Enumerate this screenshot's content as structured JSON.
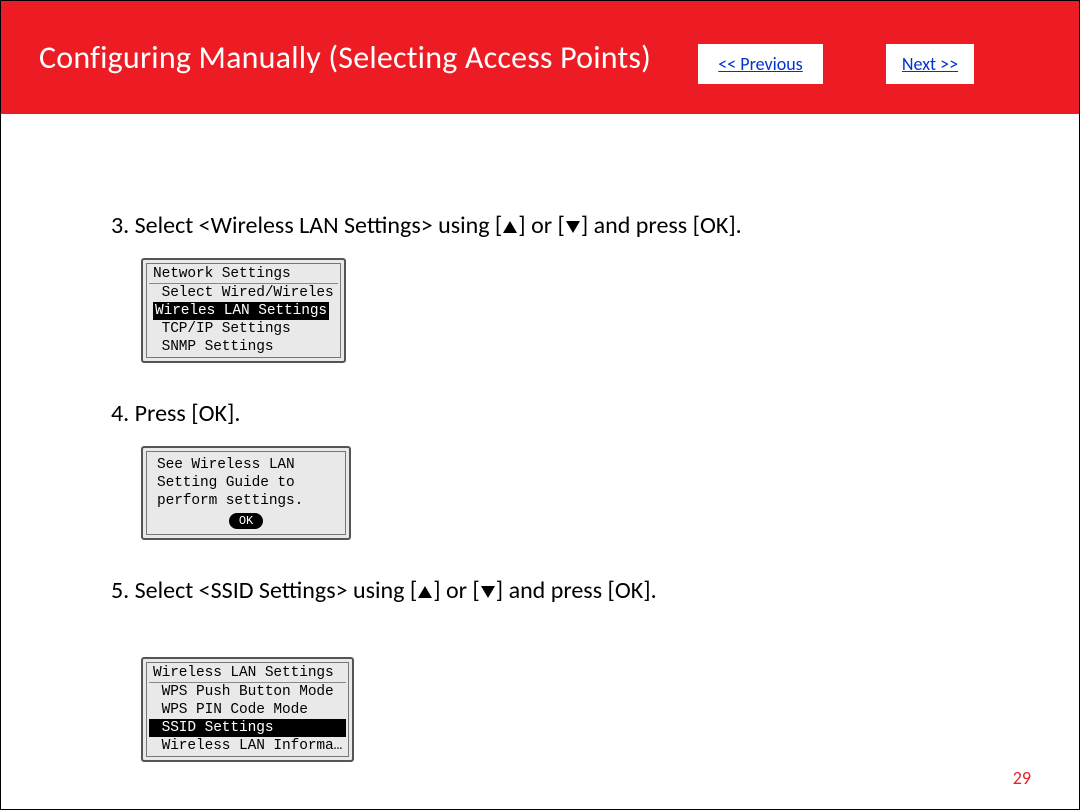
{
  "header": {
    "title": "Configuring Manually (Selecting Access Points)",
    "prev": "<< Previous",
    "next": "Next >>"
  },
  "steps": {
    "s3_pre": "3. Select <Wireless LAN Settings> using [",
    "s3_mid": "] or [",
    "s3_post": "] and press [OK].",
    "s4": "4. Press [OK].",
    "s5_pre": "5. Select <SSID Settings> using [",
    "s5_mid": "] or [",
    "s5_post": "] and press [OK]."
  },
  "lcd1": {
    "title": "Network Settings",
    "r1": " Select Wired/Wireles",
    "r2_sel": "Wireles LAN Settings",
    "r3": " TCP/IP Settings",
    "r4": " SNMP Settings"
  },
  "lcd2": {
    "l1": "See Wireless LAN",
    "l2": "Setting Guide to",
    "l3": "perform settings.",
    "ok": "OK"
  },
  "lcd3": {
    "title": "Wireless LAN Settings",
    "r1": " WPS Push Button Mode",
    "r2": " WPS PIN Code Mode",
    "r3_sel": " SSID Settings",
    "r4": " Wireless LAN Informa…"
  },
  "page": "29"
}
